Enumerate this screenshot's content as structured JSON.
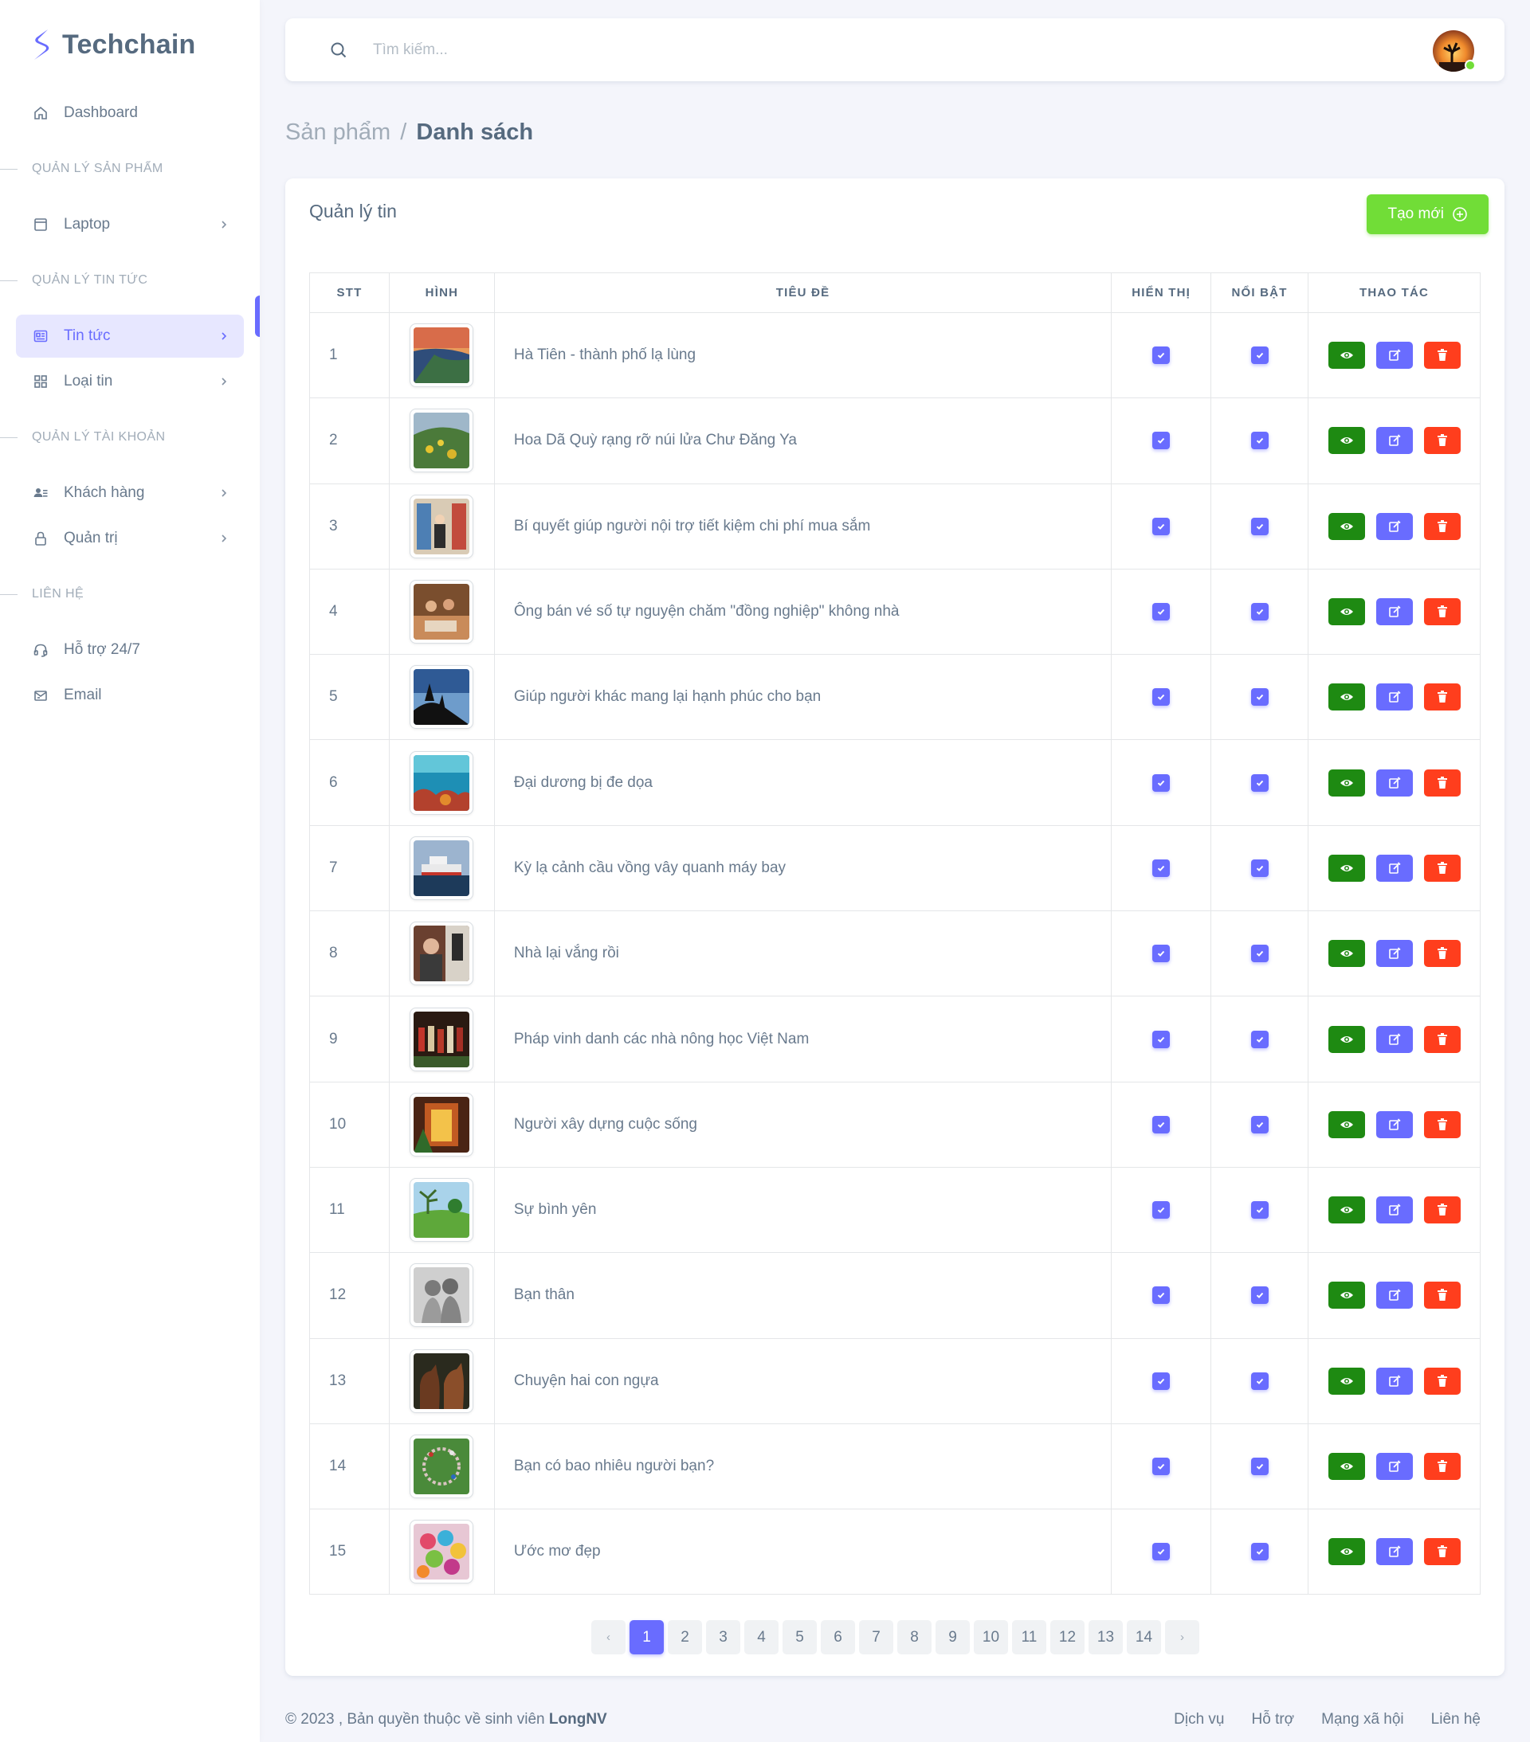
{
  "brand": {
    "name": "Techchain"
  },
  "sidebar": {
    "dashboard": "Dashboard",
    "sections": [
      {
        "header": "QUẢN LÝ SẢN PHẨM",
        "items": [
          {
            "label": "Laptop",
            "icon": "laptop-icon"
          }
        ]
      },
      {
        "header": "QUẢN LÝ TIN TỨC",
        "items": [
          {
            "label": "Tin tức",
            "icon": "news-icon",
            "active": true
          },
          {
            "label": "Loại tin",
            "icon": "grid-icon"
          }
        ]
      },
      {
        "header": "QUẢN LÝ TÀI KHOẢN",
        "items": [
          {
            "label": "Khách hàng",
            "icon": "users-icon"
          },
          {
            "label": "Quản trị",
            "icon": "lock-icon"
          }
        ]
      },
      {
        "header": "LIÊN HỆ",
        "items": [
          {
            "label": "Hỗ trợ 24/7",
            "icon": "headset-icon"
          },
          {
            "label": "Email",
            "icon": "mail-icon"
          }
        ]
      }
    ]
  },
  "search": {
    "placeholder": "Tìm kiếm..."
  },
  "breadcrumb": {
    "parent": "Sản phẩm",
    "separator": "/",
    "current": "Danh sách"
  },
  "card": {
    "title": "Quản lý tin",
    "create_label": "Tạo mới"
  },
  "table": {
    "headers": [
      "STT",
      "HÌNH",
      "TIÊU ĐỀ",
      "HIỂN THỊ",
      "NỔI BẬT",
      "THAO TÁC"
    ],
    "rows": [
      {
        "stt": "1",
        "title": "Hà Tiên - thành phố lạ lùng",
        "visible": true,
        "featured": true
      },
      {
        "stt": "2",
        "title": "Hoa Dã Quỳ rạng rỡ núi lửa Chư Đăng Ya",
        "visible": true,
        "featured": true
      },
      {
        "stt": "3",
        "title": "Bí quyết giúp người nội trợ tiết kiệm chi phí mua sắm",
        "visible": true,
        "featured": true
      },
      {
        "stt": "4",
        "title": "Ông bán vé số tự nguyện chăm \"đồng nghiệp\" không nhà",
        "visible": true,
        "featured": true
      },
      {
        "stt": "5",
        "title": "Giúp người khác mang lại hạnh phúc cho bạn",
        "visible": true,
        "featured": true
      },
      {
        "stt": "6",
        "title": "Đại dương bị đe dọa",
        "visible": true,
        "featured": true
      },
      {
        "stt": "7",
        "title": "Kỳ lạ cảnh cầu vồng vây quanh máy bay",
        "visible": true,
        "featured": true
      },
      {
        "stt": "8",
        "title": "Nhà lại vắng rồi",
        "visible": true,
        "featured": true
      },
      {
        "stt": "9",
        "title": "Pháp vinh danh các nhà nông học Việt Nam",
        "visible": true,
        "featured": true
      },
      {
        "stt": "10",
        "title": "Người xây dựng cuộc sống",
        "visible": true,
        "featured": true
      },
      {
        "stt": "11",
        "title": "Sự bình yên",
        "visible": true,
        "featured": true
      },
      {
        "stt": "12",
        "title": "Bạn thân",
        "visible": true,
        "featured": true
      },
      {
        "stt": "13",
        "title": "Chuyện hai con ngựa",
        "visible": true,
        "featured": true
      },
      {
        "stt": "14",
        "title": "Bạn có bao nhiêu người bạn?",
        "visible": true,
        "featured": true
      },
      {
        "stt": "15",
        "title": "Ước mơ đẹp",
        "visible": true,
        "featured": true
      }
    ]
  },
  "pagination": {
    "prev": "‹",
    "next": "›",
    "pages": [
      "1",
      "2",
      "3",
      "4",
      "5",
      "6",
      "7",
      "8",
      "9",
      "10",
      "11",
      "12",
      "13",
      "14"
    ],
    "current": "1"
  },
  "footer": {
    "copyright_prefix": "© 2023 , Bản quyền thuộc về sinh viên ",
    "author": "LongNV",
    "links": [
      "Dịch vụ",
      "Hỗ trợ",
      "Mạng xã hội",
      "Liên hệ"
    ]
  },
  "colors": {
    "primary": "#696cff",
    "success": "#71dd37",
    "view": "#1e8a12",
    "danger": "#ff3e1d"
  }
}
